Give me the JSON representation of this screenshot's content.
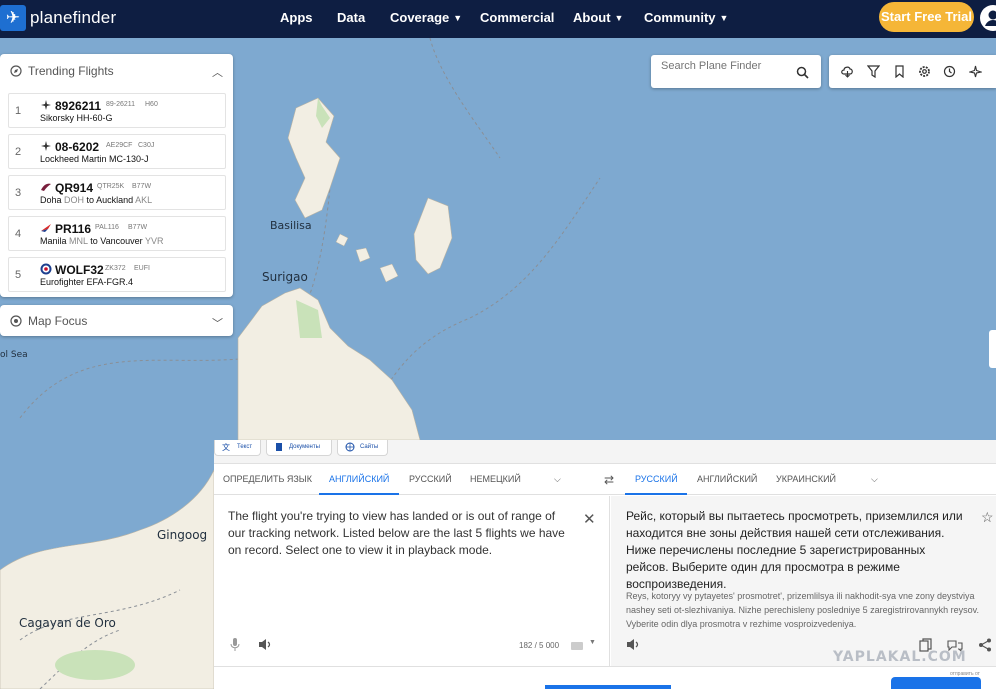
{
  "nav": {
    "brand": "planefinder",
    "items": [
      {
        "label": "Apps",
        "dropdown": false
      },
      {
        "label": "Data",
        "dropdown": false
      },
      {
        "label": "Coverage",
        "dropdown": true
      },
      {
        "label": "Commercial",
        "dropdown": false
      },
      {
        "label": "About",
        "dropdown": true
      },
      {
        "label": "Community",
        "dropdown": true
      }
    ],
    "cta": "Start Free Trial",
    "colors": {
      "bar": "#0e1e42",
      "cta": "#f5b637",
      "brand": "#1e6fd1"
    }
  },
  "trending": {
    "title": "Trending Flights",
    "flights": [
      {
        "rank": "1",
        "callsign": "8926211",
        "reg": "89-26211",
        "type": "H60",
        "line": "Sikorsky HH-60-G",
        "icon": "military-plane-icon"
      },
      {
        "rank": "2",
        "callsign": "08-6202",
        "reg": "AE29CF",
        "type": "C30J",
        "line": "Lockheed Martin MC-130-J",
        "icon": "military-plane-icon"
      },
      {
        "rank": "3",
        "callsign": "QR914",
        "reg": "QTR25K",
        "type": "B77W",
        "from": "Doha",
        "from_code": "DOH",
        "to_word": "to",
        "to": "Auckland",
        "to_code": "AKL",
        "icon": "qatar-airways-logo-icon"
      },
      {
        "rank": "4",
        "callsign": "PR116",
        "reg": "PAL116",
        "type": "B77W",
        "from": "Manila",
        "from_code": "MNL",
        "to_word": "to",
        "to": "Vancouver",
        "to_code": "YVR",
        "icon": "philippine-airlines-logo-icon"
      },
      {
        "rank": "5",
        "callsign": "WOLF32",
        "reg": "ZK372",
        "type": "EUFI",
        "line": "Eurofighter EFA-FGR.4",
        "icon": "raf-roundel-icon"
      }
    ]
  },
  "map_focus": {
    "title": "Map Focus"
  },
  "search": {
    "placeholder": "Search Plane Finder"
  },
  "map": {
    "labels": {
      "basilisa": "Basilisa",
      "surigao": "Surigao",
      "sea": "ol Sea",
      "gingoog": "Gingoog",
      "cagayan": "Cagayan de Oro"
    },
    "colors": {
      "water": "#7ea9d0",
      "land": "#f2eee3",
      "park": "#c9e2b9"
    }
  },
  "translator": {
    "modes": [
      "Текст",
      "Документы",
      "Сайты"
    ],
    "source_langs": [
      "ОПРЕДЕЛИТЬ ЯЗЫК",
      "АНГЛИЙСКИЙ",
      "РУССКИЙ",
      "НЕМЕЦКИЙ"
    ],
    "target_langs": [
      "РУССКИЙ",
      "АНГЛИЙСКИЙ",
      "УКРАИНСКИЙ"
    ],
    "source_text": "The flight you're trying to view has landed or is out of range of our tracking network. Listed below are the last 5 flights we have on record. Select one to view it in playback mode.",
    "char_count": "182 / 5 000",
    "target_text": "Рейс, который вы пытаетесь просмотреть, приземлился или находится вне зоны действия нашей сети отслеживания. Ниже перечислены последние 5 зарегистрированных рейсов. Выберите один для просмотра в режиме воспроизведения.",
    "transliteration": "Reys, kotoryy vy pytayetes' prosmotret', prizemlilsya ili nakhodit-sya vne zony deystviya nashey seti ot-slezhivaniya. Nizhe perechisleny posledniye 5 zaregistrirovannykh reysov. Vyberite odin dlya prosmotra v rezhime vosproizvedeniya.",
    "accent": "#1a73e8"
  },
  "watermark": {
    "text": "YAPLAKAL.COM",
    "sub": "отправить от"
  }
}
